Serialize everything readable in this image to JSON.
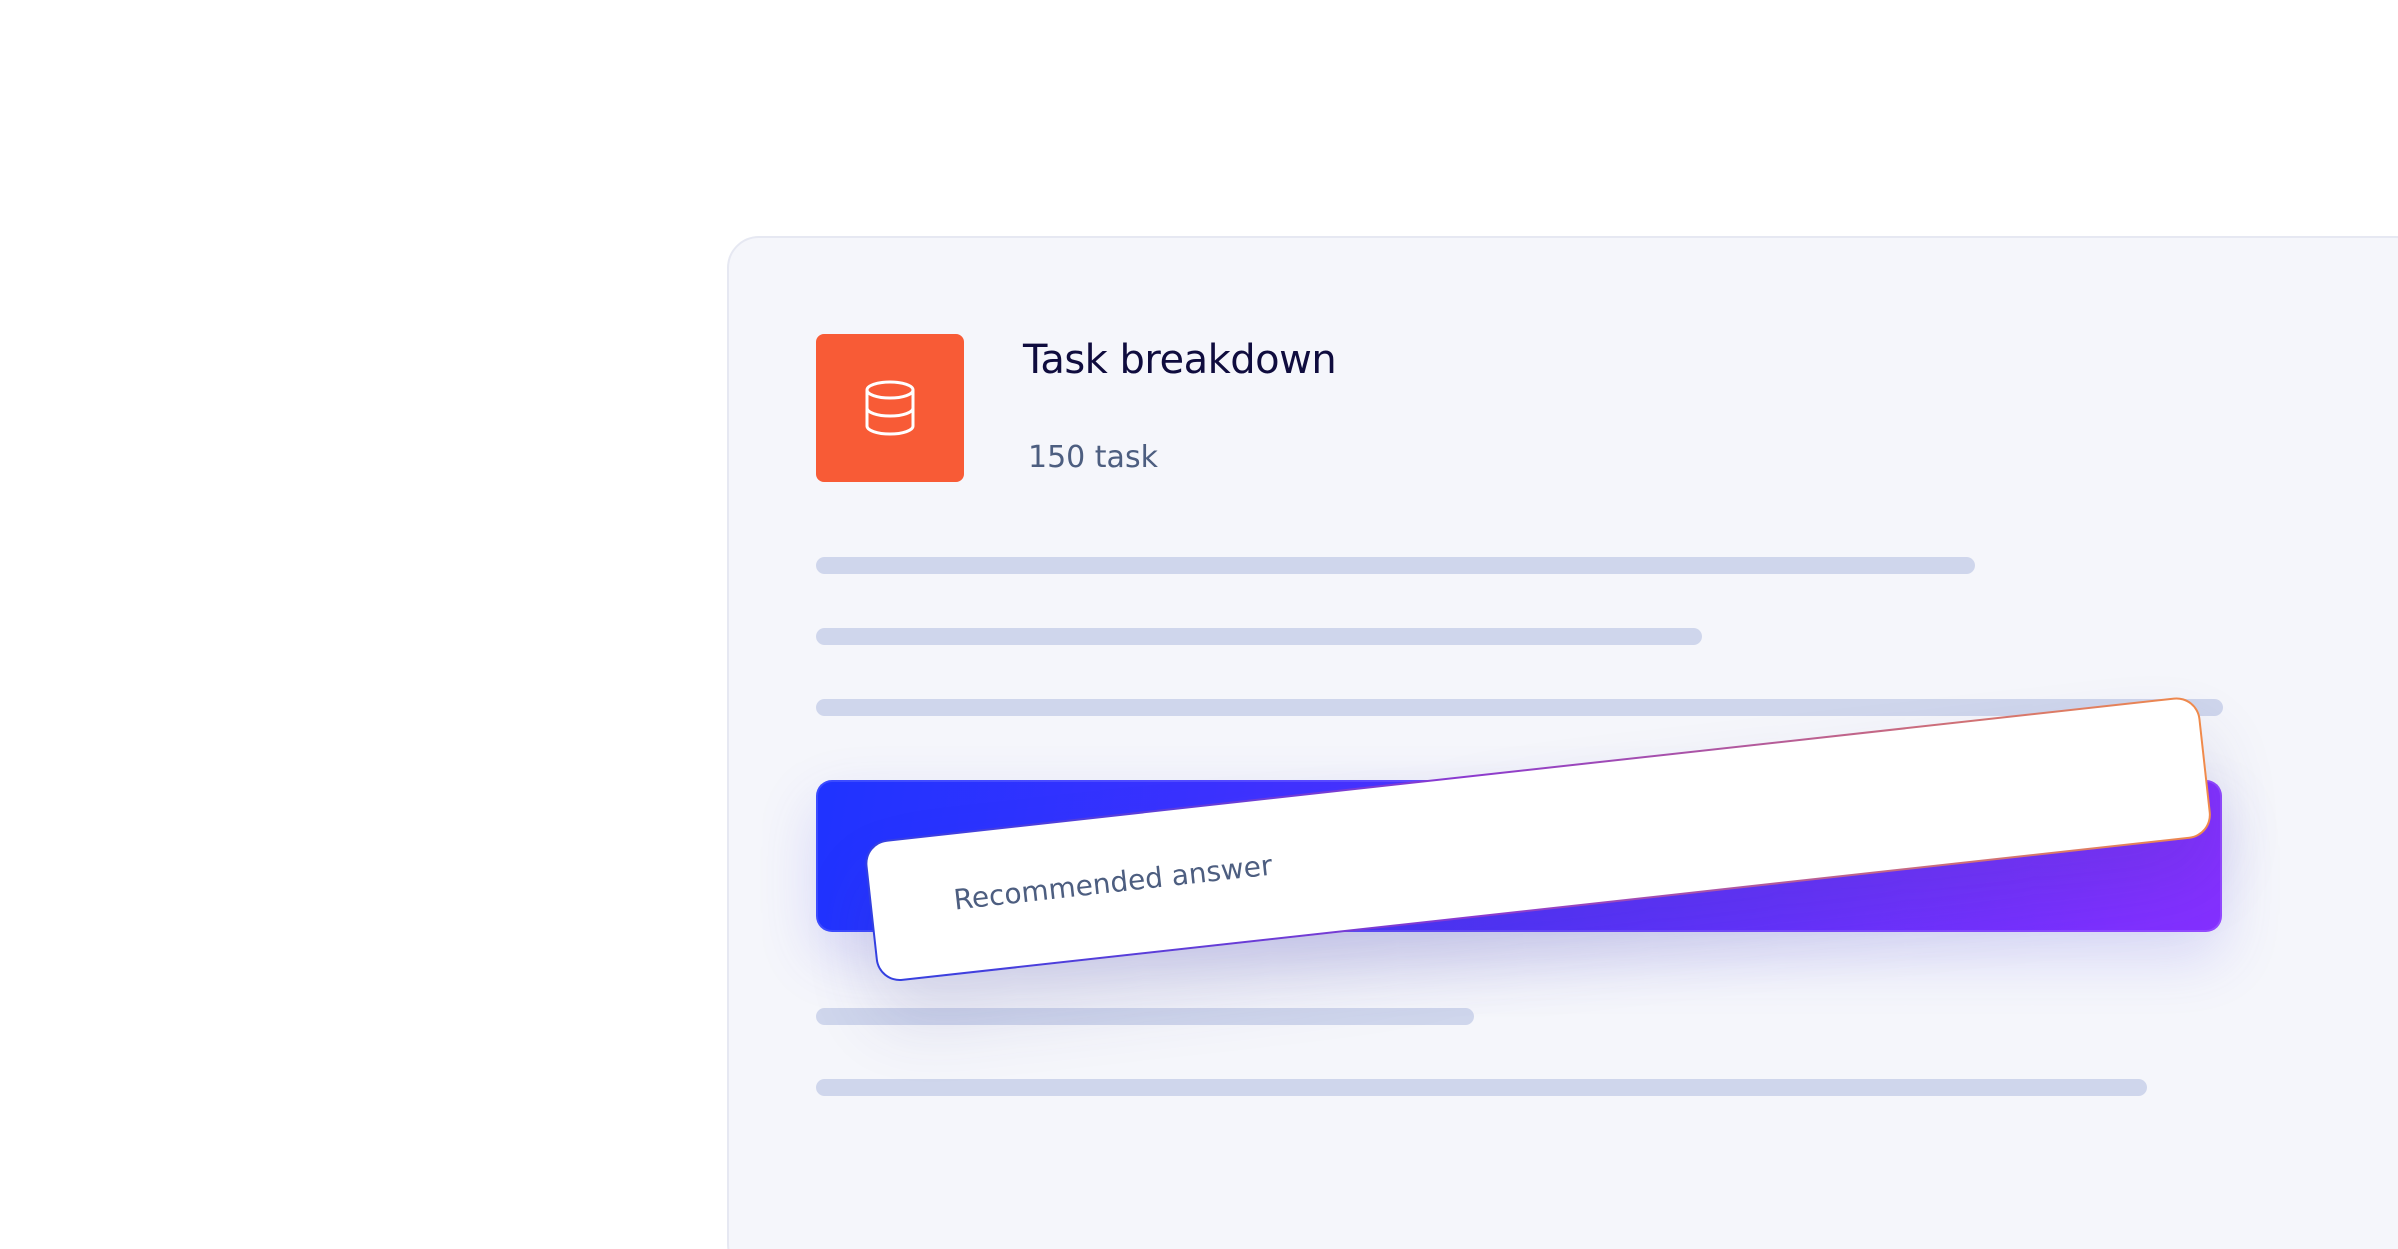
{
  "card": {
    "icon": "database-icon",
    "title": "Task breakdown",
    "subtitle": "150 task"
  },
  "recommendation": {
    "label": "Recommended answer"
  },
  "colors": {
    "page_bg": "#ffffff",
    "card_bg": "#f5f6fb",
    "icon_tile": "#f85b36",
    "title_text": "#0f0c3e",
    "subtitle_text": "#4d5e80",
    "skeleton": "#cfd6ec",
    "gradient_start": "#1f33ff",
    "gradient_end": "#8530ff",
    "tilted_border_start": "#3340e0",
    "tilted_border_mid": "#8b3ad0",
    "tilted_border_end": "#f08a4b",
    "tilted_text": "#4d5e80"
  }
}
